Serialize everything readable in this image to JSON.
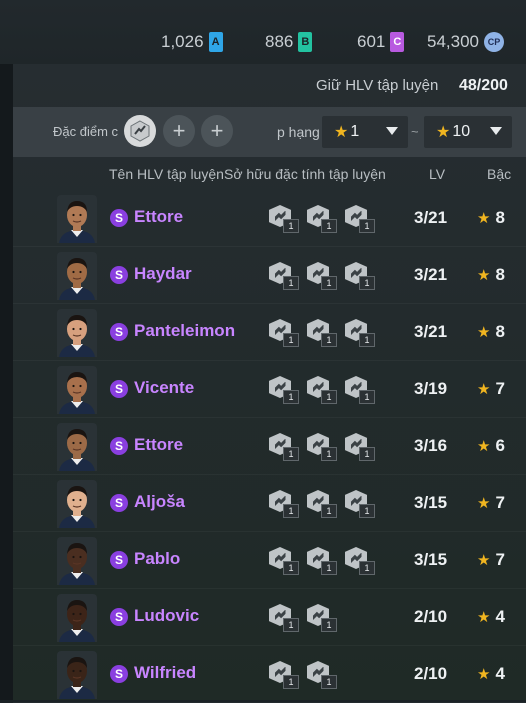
{
  "currency": {
    "a_value": "1,026",
    "a_letter": "A",
    "b_value": "886",
    "b_letter": "B",
    "c_value": "601",
    "c_letter": "C",
    "points_value": "54,300",
    "points_letter": "CP"
  },
  "capacity": {
    "label": "Giữ HLV tập luyện",
    "value": "48/200"
  },
  "filter": {
    "trait_label": "Đặc điểm c",
    "rank_label": "p hạng",
    "rank_min": "1",
    "rank_max": "10",
    "tilde": "~",
    "plus": "+"
  },
  "columns": {
    "name": "Tên HLV tập luyện",
    "traits": "Sở hữu đặc tính tập luyện",
    "lv": "LV",
    "grade": "Bậc"
  },
  "rows": [
    {
      "name": "Ettore",
      "lv": "3/21",
      "grade": "8",
      "badge": "S",
      "traits": [
        "1",
        "1",
        "1"
      ]
    },
    {
      "name": "Haydar",
      "lv": "3/21",
      "grade": "8",
      "badge": "S",
      "traits": [
        "1",
        "1",
        "1"
      ]
    },
    {
      "name": "Panteleimon",
      "lv": "3/21",
      "grade": "8",
      "badge": "S",
      "traits": [
        "1",
        "1",
        "1"
      ]
    },
    {
      "name": "Vicente",
      "lv": "3/19",
      "grade": "7",
      "badge": "S",
      "traits": [
        "1",
        "1",
        "1"
      ]
    },
    {
      "name": "Ettore",
      "lv": "3/16",
      "grade": "6",
      "badge": "S",
      "traits": [
        "1",
        "1",
        "1"
      ]
    },
    {
      "name": "Aljoša",
      "lv": "3/15",
      "grade": "7",
      "badge": "S",
      "traits": [
        "1",
        "1",
        "1"
      ]
    },
    {
      "name": "Pablo",
      "lv": "3/15",
      "grade": "7",
      "badge": "S",
      "traits": [
        "1",
        "1",
        "1"
      ]
    },
    {
      "name": "Ludovic",
      "lv": "2/10",
      "grade": "4",
      "badge": "S",
      "traits": [
        "1",
        "1"
      ]
    },
    {
      "name": "Wilfried",
      "lv": "2/10",
      "grade": "4",
      "badge": "S",
      "traits": [
        "1",
        "1"
      ]
    }
  ],
  "skin_tones": [
    "#b07a55",
    "#a06b45",
    "#d7a07e",
    "#a8704c",
    "#9c6a47",
    "#e0b08e",
    "#4a2e20",
    "#3d2418",
    "#3a2418"
  ],
  "colors": {
    "accent_purple": "#8a3fe0",
    "name_purple": "#c885ff",
    "star_gold": "#f0b520"
  }
}
